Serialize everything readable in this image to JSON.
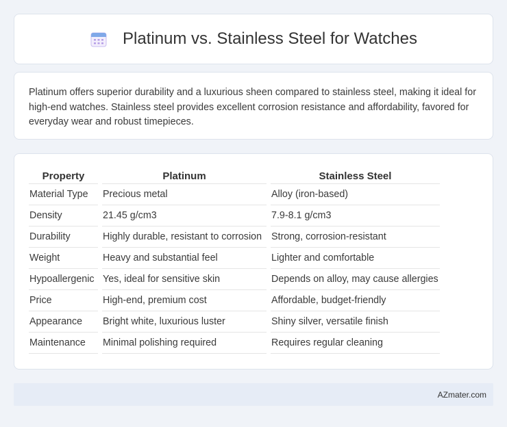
{
  "header": {
    "title": "Platinum vs. Stainless Steel for Watches",
    "icon": "calendar-icon"
  },
  "summary": {
    "text": "Platinum offers superior durability and a luxurious sheen compared to stainless steel, making it ideal for high-end watches. Stainless steel provides excellent corrosion resistance and affordability, favored for everyday wear and robust timepieces."
  },
  "table": {
    "columns": [
      "Property",
      "Platinum",
      "Stainless Steel"
    ],
    "rows": [
      [
        "Material Type",
        "Precious metal",
        "Alloy (iron-based)"
      ],
      [
        "Density",
        "21.45 g/cm3",
        "7.9-8.1 g/cm3"
      ],
      [
        "Durability",
        "Highly durable, resistant to corrosion",
        "Strong, corrosion-resistant"
      ],
      [
        "Weight",
        "Heavy and substantial feel",
        "Lighter and comfortable"
      ],
      [
        "Hypoallergenic",
        "Yes, ideal for sensitive skin",
        "Depends on alloy, may cause allergies"
      ],
      [
        "Price",
        "High-end, premium cost",
        "Affordable, budget-friendly"
      ],
      [
        "Appearance",
        "Bright white, luxurious luster",
        "Shiny silver, versatile finish"
      ],
      [
        "Maintenance",
        "Minimal polishing required",
        "Requires regular cleaning"
      ]
    ]
  },
  "footer": {
    "brand": "AZmater.com"
  },
  "colors": {
    "page_background": "#f0f3f8",
    "card_background": "#ffffff",
    "footer_background": "#e6ecf6",
    "icon_accent": "#8e7fd6"
  }
}
